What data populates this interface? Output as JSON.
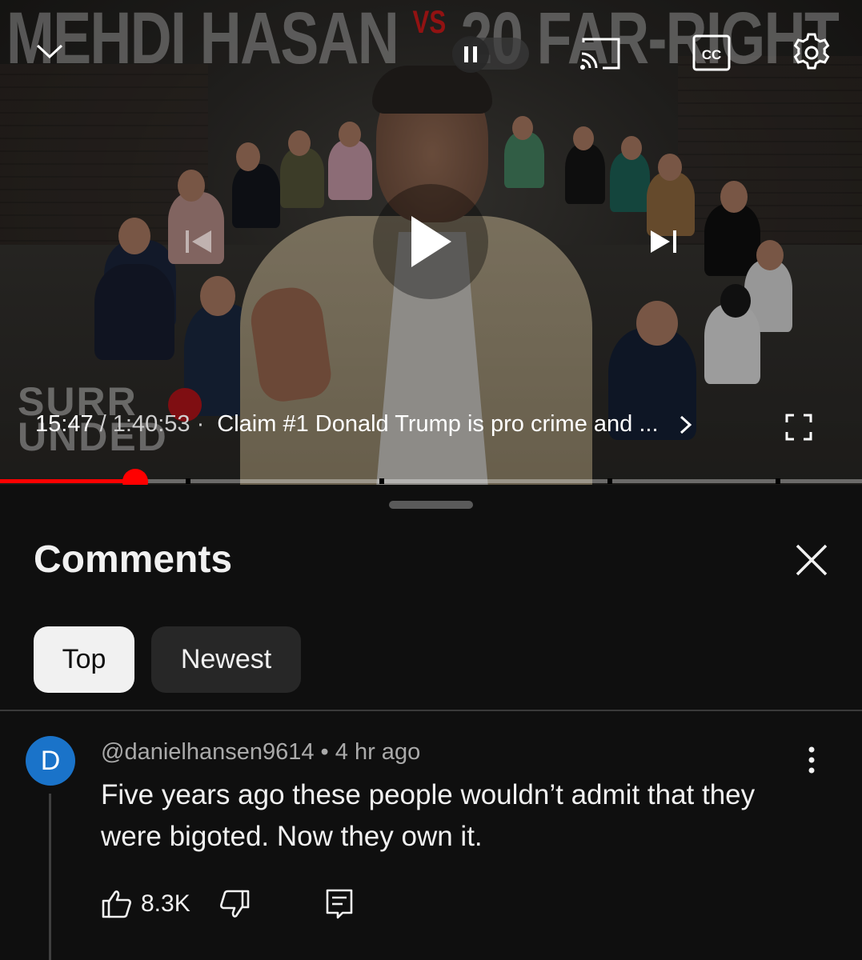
{
  "player": {
    "thumbnail_title_left": "MEHDI HASAN",
    "thumbnail_title_vs": "VS",
    "thumbnail_title_right": "20 FAR-RIGHT",
    "brand_line1": "SURR",
    "brand_line2": "UNDED",
    "current_time": "15:47",
    "separator": " / ",
    "total_time": "1:40:53",
    "chapter_prefix": " · ",
    "chapter_title": "Claim #1 Donald Trump is pro crime and ...",
    "progress_fraction": 0.157,
    "chapter_markers": [
      0.215,
      0.44,
      0.705,
      0.9
    ],
    "accent_color": "#ff0000",
    "icons": {
      "collapse": "chevron-down-icon",
      "autoplay": "autoplay-toggle-icon",
      "cast": "cast-icon",
      "captions": "cc-icon",
      "settings": "gear-icon",
      "previous": "skip-previous-icon",
      "play": "play-icon",
      "next": "skip-next-icon",
      "chapter_expand": "chevron-right-icon",
      "fullscreen": "fullscreen-icon"
    }
  },
  "comments": {
    "title": "Comments",
    "close_icon": "close-icon",
    "filters": {
      "top": "Top",
      "newest": "Newest",
      "selected": "Top"
    },
    "items": [
      {
        "avatar_letter": "D",
        "avatar_color": "#1a73c9",
        "author": "@danielhansen9614",
        "dot": " • ",
        "time": "4 hr ago",
        "text": "Five years ago these people wouldn’t admit that they were bigoted. Now they own it.",
        "likes": "8.3K"
      }
    ]
  }
}
